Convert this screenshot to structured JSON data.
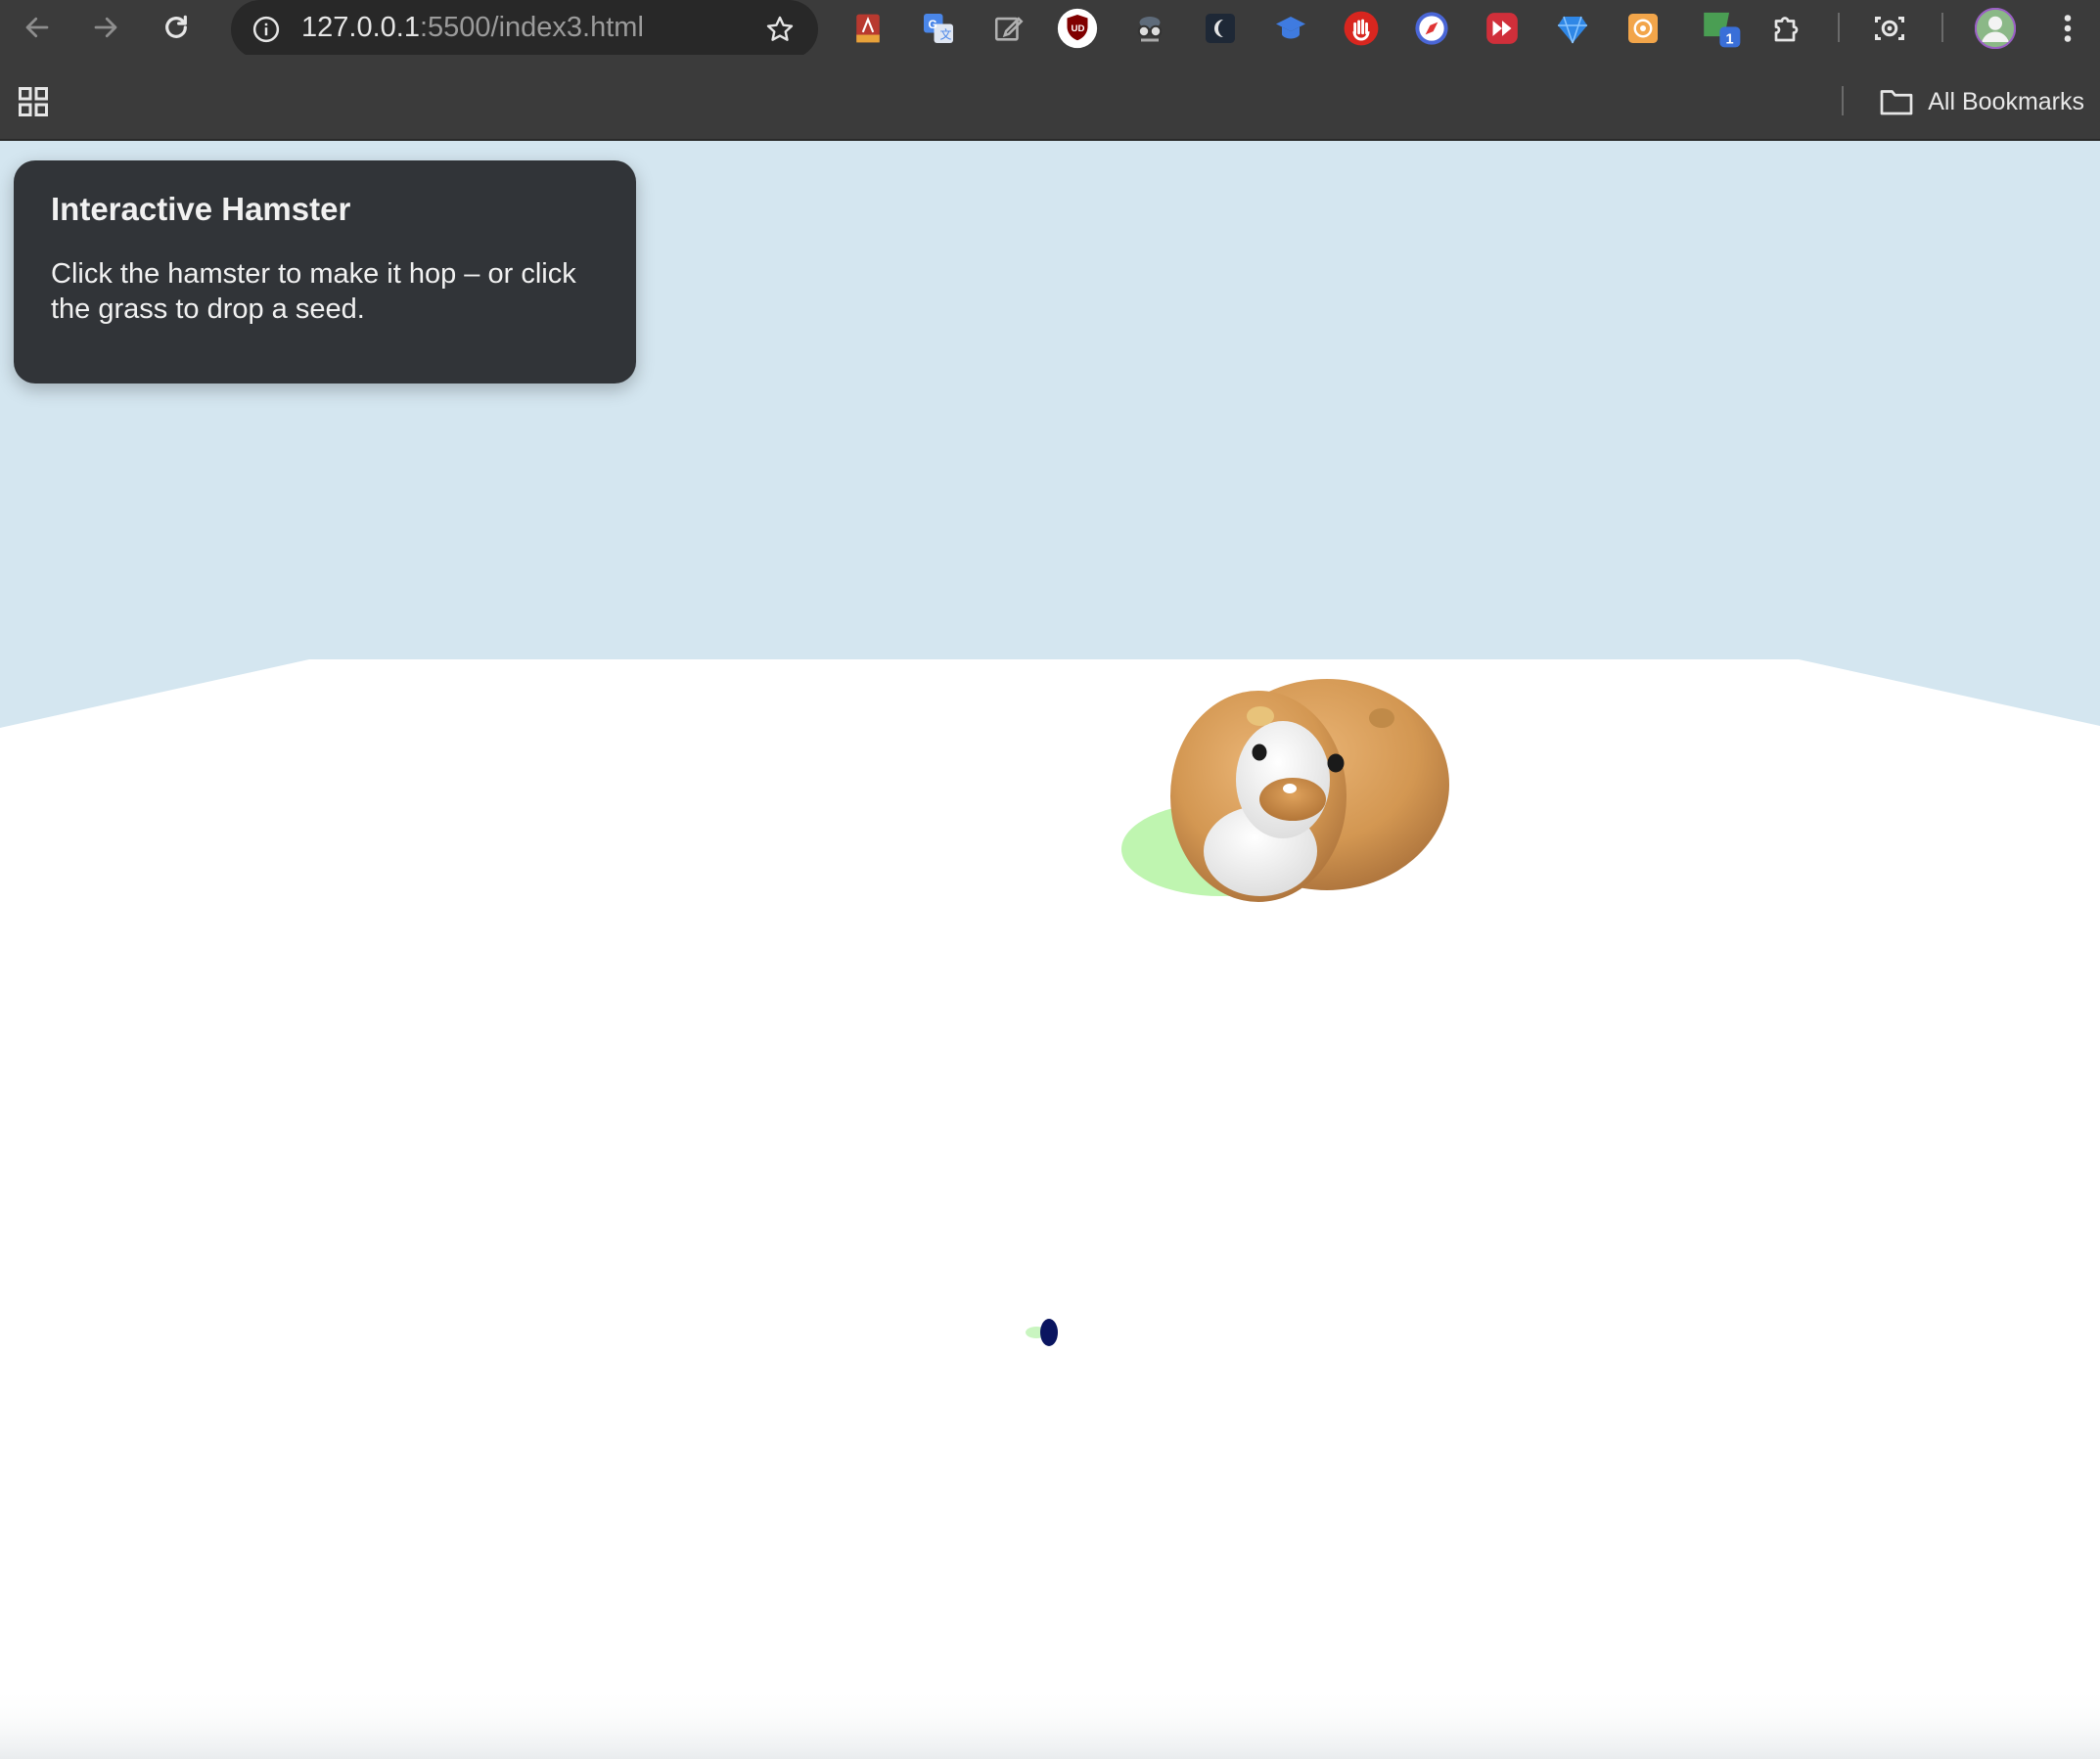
{
  "browser": {
    "url_host": "127.0.0.1",
    "url_rest": ":5500/index3.html",
    "bookmarks_label": "All Bookmarks",
    "extension_badge": "1",
    "icons": {
      "back": "arrow-left-icon",
      "forward": "arrow-right-icon",
      "reload": "reload-icon",
      "site_info": "info-icon",
      "bookmark_star": "star-icon",
      "extensions": "puzzle-icon",
      "screenshot": "camera-icon",
      "menu": "kebab-menu-icon",
      "apps": "apps-grid-icon",
      "bookmarks_folder": "folder-icon"
    }
  },
  "panel": {
    "title": "Interactive Hamster",
    "instructions": "Click the hamster to make it hop – or click the grass to drop a seed."
  },
  "scene": {
    "sky_color": "#d4e6f0",
    "ground_color": "#ffffff",
    "hamster_fur_color": "#d49a55",
    "shadow_color": "#bff5b0",
    "seed_color": "#0a1560"
  }
}
